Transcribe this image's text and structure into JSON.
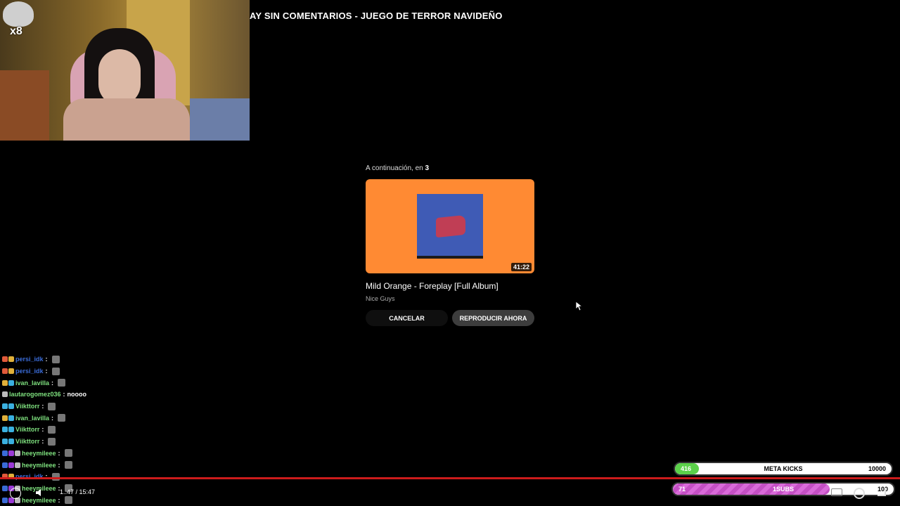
{
  "overlay": {
    "cat_label": "x8",
    "video_title": "AY SIN COMENTARIOS - JUEGO DE TERROR NAVIDEÑO"
  },
  "upnext": {
    "label_prefix": "A continuación, en",
    "countdown": "3",
    "video_title": "Mild Orange - Foreplay [Full Album]",
    "channel": "Nice Guys",
    "duration": "41:22",
    "cancel_label": "CANCELAR",
    "play_now_label": "REPRODUCIR AHORA",
    "thumb_color": "#ff8a33"
  },
  "chat": [
    {
      "user": "persi_idk",
      "color": "#3a6bd6",
      "badges": [
        "#e05a3a",
        "#e0b03a"
      ],
      "msg": "",
      "emote": true
    },
    {
      "user": "persi_idk",
      "color": "#3a6bd6",
      "badges": [
        "#e05a3a",
        "#e0b03a"
      ],
      "msg": "",
      "emote": true
    },
    {
      "user": "ivan_lavilla",
      "color": "#7ee07e",
      "badges": [
        "#e0b03a",
        "#3ab0e0"
      ],
      "msg": "",
      "emote": true
    },
    {
      "user": "lautarogomez036",
      "color": "#7ee07e",
      "badges": [
        "#bbbbbb"
      ],
      "msg": "noooo",
      "emote": false
    },
    {
      "user": "Viikttorr",
      "color": "#7ee07e",
      "badges": [
        "#3ab0e0",
        "#3ab0e0"
      ],
      "msg": "",
      "emote": true
    },
    {
      "user": "ivan_lavilla",
      "color": "#7ee07e",
      "badges": [
        "#e0b03a",
        "#3ab0e0"
      ],
      "msg": "",
      "emote": true
    },
    {
      "user": "Viikttorr",
      "color": "#7ee07e",
      "badges": [
        "#3ab0e0",
        "#3ab0e0"
      ],
      "msg": "",
      "emote": true
    },
    {
      "user": "Viikttorr",
      "color": "#7ee07e",
      "badges": [
        "#3ab0e0",
        "#3ab0e0"
      ],
      "msg": "",
      "emote": true
    },
    {
      "user": "heeymileee",
      "color": "#7ee07e",
      "badges": [
        "#3a6bd6",
        "#9a3ad6",
        "#bbbbbb"
      ],
      "msg": "",
      "emote": true
    },
    {
      "user": "heeymileee",
      "color": "#7ee07e",
      "badges": [
        "#3a6bd6",
        "#9a3ad6",
        "#bbbbbb"
      ],
      "msg": "",
      "emote": true
    },
    {
      "user": "persi_idk",
      "color": "#3a6bd6",
      "badges": [
        "#e05a3a",
        "#e0b03a"
      ],
      "msg": "",
      "emote": true
    },
    {
      "user": "heeymileee",
      "color": "#7ee07e",
      "badges": [
        "#3a6bd6",
        "#9a3ad6",
        "#bbbbbb"
      ],
      "msg": "",
      "emote": true
    },
    {
      "user": "heeymileee",
      "color": "#7ee07e",
      "badges": [
        "#3a6bd6",
        "#9a3ad6",
        "#bbbbbb"
      ],
      "msg": "",
      "emote": true
    }
  ],
  "player": {
    "time": "1..47 / 15:47",
    "progress_fraction": 1.0
  },
  "meta_kicks": {
    "current": "416",
    "label": "META KICKS",
    "goal": "10000",
    "fill_fraction": 0.11,
    "fill_color": "#5bd14a"
  },
  "meta_subs": {
    "current": "71",
    "label": "1SUBS",
    "goal": "100",
    "fill_fraction": 0.71,
    "fill_color": "#d96ad9"
  }
}
